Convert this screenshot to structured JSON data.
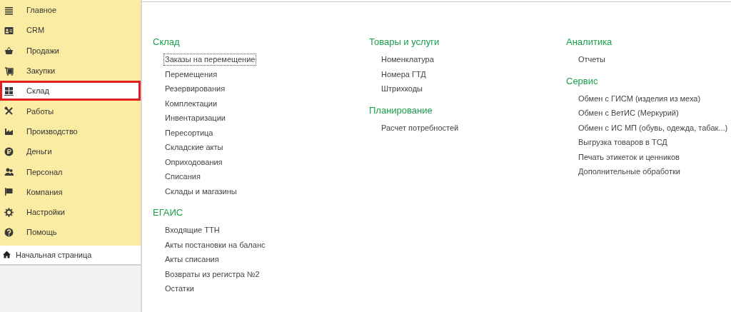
{
  "sidebar": {
    "items": [
      {
        "label": "Главное",
        "selected": false
      },
      {
        "label": "CRM",
        "selected": false
      },
      {
        "label": "Продажи",
        "selected": false
      },
      {
        "label": "Закупки",
        "selected": false
      },
      {
        "label": "Склад",
        "selected": true
      },
      {
        "label": "Работы",
        "selected": false
      },
      {
        "label": "Производство",
        "selected": false
      },
      {
        "label": "Деньги",
        "selected": false
      },
      {
        "label": "Персонал",
        "selected": false
      },
      {
        "label": "Компания",
        "selected": false
      },
      {
        "label": "Настройки",
        "selected": false
      },
      {
        "label": "Помощь",
        "selected": false
      }
    ],
    "home": {
      "label": "Начальная страница"
    }
  },
  "columns": [
    [
      {
        "title": "Склад",
        "items": [
          {
            "label": "Заказы на перемещение",
            "focused": true
          },
          {
            "label": "Перемещения",
            "focused": false
          },
          {
            "label": "Резервирования",
            "focused": false
          },
          {
            "label": "Комплектации",
            "focused": false
          },
          {
            "label": "Инвентаризации",
            "focused": false
          },
          {
            "label": "Пересортица",
            "focused": false
          },
          {
            "label": "Складские акты",
            "focused": false
          },
          {
            "label": "Оприходования",
            "focused": false
          },
          {
            "label": "Списания",
            "focused": false
          },
          {
            "label": "Склады и магазины",
            "focused": false
          }
        ]
      },
      {
        "title": "ЕГАИС",
        "items": [
          {
            "label": "Входящие ТТН",
            "focused": false
          },
          {
            "label": "Акты постановки на баланс",
            "focused": false
          },
          {
            "label": "Акты списания",
            "focused": false
          },
          {
            "label": "Возвраты из регистра №2",
            "focused": false
          },
          {
            "label": "Остатки",
            "focused": false
          }
        ]
      }
    ],
    [
      {
        "title": "Товары и услуги",
        "items": [
          {
            "label": "Номенклатура",
            "focused": false
          },
          {
            "label": "Номера ГТД",
            "focused": false
          },
          {
            "label": "Штрихкоды",
            "focused": false
          }
        ]
      },
      {
        "title": "Планирование",
        "items": [
          {
            "label": "Расчет потребностей",
            "focused": false
          }
        ]
      }
    ],
    [
      {
        "title": "Аналитика",
        "items": [
          {
            "label": "Отчеты",
            "focused": false
          }
        ]
      },
      {
        "title": "Сервис",
        "items": [
          {
            "label": "Обмен с ГИСМ (изделия из меха)",
            "focused": false
          },
          {
            "label": "Обмен с ВетИС (Меркурий)",
            "focused": false
          },
          {
            "label": "Обмен с ИС МП (обувь, одежда, табак...)",
            "focused": false
          },
          {
            "label": "Выгрузка товаров в ТСД",
            "focused": false
          },
          {
            "label": "Печать этикеток и ценников",
            "focused": false
          },
          {
            "label": "Дополнительные обработки",
            "focused": false
          }
        ]
      }
    ]
  ]
}
